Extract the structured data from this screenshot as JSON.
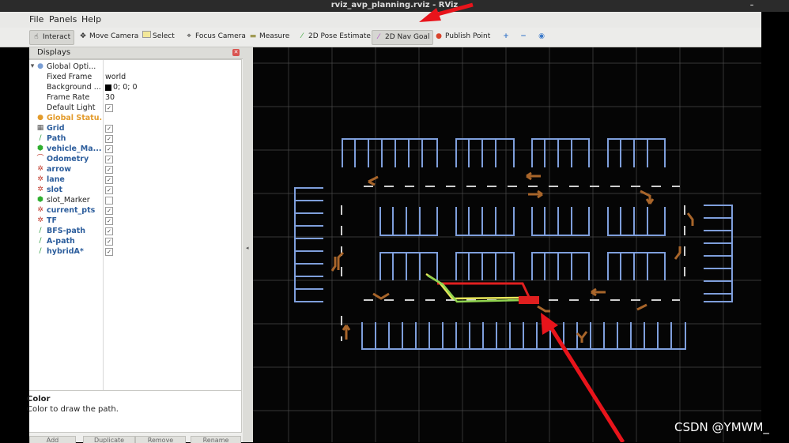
{
  "window": {
    "title": "rviz_avp_planning.rviz - RViz"
  },
  "menu": {
    "file": "File",
    "panels": "Panels",
    "help": "Help"
  },
  "toolbar": {
    "interact": "Interact",
    "move_camera": "Move Camera",
    "select": "Select",
    "focus_camera": "Focus Camera",
    "measure": "Measure",
    "pose_estimate": "2D Pose Estimate",
    "nav_goal": "2D Nav Goal",
    "publish_point": "Publish Point"
  },
  "displays": {
    "title": "Displays",
    "global_options": {
      "label": "Global Opti...",
      "expanded": true
    },
    "properties": [
      {
        "name": "Fixed Frame",
        "value": "world"
      },
      {
        "name": "Background ...",
        "value": "0; 0; 0"
      },
      {
        "name": "Frame Rate",
        "value": "30"
      },
      {
        "name": "Default Light",
        "value": "✓"
      }
    ],
    "global_status": "Global Statu...",
    "items": [
      {
        "label": "Grid",
        "icon": "grid-icon",
        "checked": true
      },
      {
        "label": "Path",
        "icon": "path-icon",
        "checked": true
      },
      {
        "label": "vehicle_Ma...",
        "icon": "marker-icon",
        "checked": true
      },
      {
        "label": "Odometry",
        "icon": "odometry-icon",
        "checked": true
      },
      {
        "label": "arrow",
        "icon": "marker-array-icon",
        "checked": true
      },
      {
        "label": "lane",
        "icon": "marker-array-icon",
        "checked": true
      },
      {
        "label": "slot",
        "icon": "marker-array-icon",
        "checked": true
      },
      {
        "label": "slot_Marker",
        "icon": "marker-icon",
        "checked": false
      },
      {
        "label": "current_pts",
        "icon": "marker-array-icon",
        "checked": true
      },
      {
        "label": "TF",
        "icon": "tf-icon",
        "checked": true
      },
      {
        "label": "BFS-path",
        "icon": "path-icon",
        "checked": true
      },
      {
        "label": "A-path",
        "icon": "path-icon",
        "checked": true
      },
      {
        "label": "hybridA*",
        "icon": "path-icon",
        "checked": true
      }
    ],
    "description": {
      "heading": "Color",
      "text": "Color to draw the path."
    },
    "buttons": [
      "Add",
      "Duplicate",
      "Remove",
      "Rename"
    ]
  },
  "colors": {
    "slot_lines": "#7f9fdc",
    "arrows": "#a8652a",
    "path_red": "#e01f1f",
    "path_yellow": "#e8e85a",
    "path_green": "#8fd34f",
    "annotation_arrow": "#e8141b"
  },
  "watermark": "CSDN @YMWM_"
}
